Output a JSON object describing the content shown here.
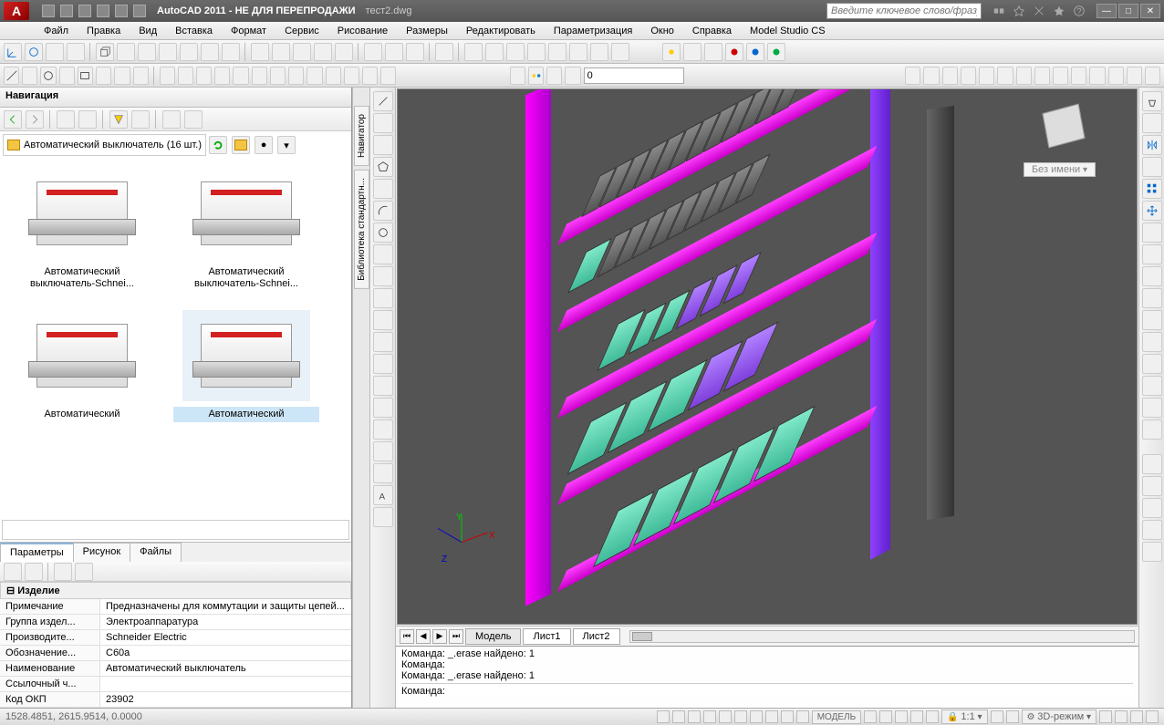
{
  "title": {
    "app": "AutoCAD 2011",
    "subtitle": "НЕ ДЛЯ ПЕРЕПРОДАЖИ",
    "file": "тест2.dwg"
  },
  "search": {
    "placeholder": "Введите ключевое слово/фразу"
  },
  "menu": [
    "Файл",
    "Правка",
    "Вид",
    "Вставка",
    "Формат",
    "Сервис",
    "Рисование",
    "Размеры",
    "Редактировать",
    "Параметризация",
    "Окно",
    "Справка",
    "Model Studio CS"
  ],
  "layer_value": "0",
  "nav": {
    "title": "Навигация",
    "path": "Автоматический выключатель (16 шт.)",
    "items": [
      {
        "label": "Автоматический выключатель-Schnei..."
      },
      {
        "label": "Автоматический выключатель-Schnei..."
      },
      {
        "label": "Автоматический"
      },
      {
        "label": "Автоматический"
      }
    ]
  },
  "sidetabs": [
    "Навигатор",
    "Библиотека стандартн..."
  ],
  "props": {
    "tabs": [
      "Параметры",
      "Рисунок",
      "Файлы"
    ],
    "section": "Изделие",
    "rows": [
      {
        "k": "Примечание",
        "v": "Предназначены для коммутации и  защиты цепей..."
      },
      {
        "k": "Группа издел...",
        "v": "Электроаппаратура"
      },
      {
        "k": "Производите...",
        "v": "Schneider Electric"
      },
      {
        "k": "Обозначение...",
        "v": "C60a"
      },
      {
        "k": "Наименование",
        "v": "Автоматический выключатель"
      },
      {
        "k": "Ссылочный ч...",
        "v": ""
      },
      {
        "k": "Код ОКП",
        "v": "23902"
      }
    ]
  },
  "viewport": {
    "unnamed": "Без имени",
    "axes": {
      "x": "X",
      "y": "Y",
      "z": "Z"
    }
  },
  "model_tabs": [
    "Модель",
    "Лист1",
    "Лист2"
  ],
  "cmd": {
    "lines": [
      "Команда: _.erase найдено: 1",
      "Команда:",
      "Команда: _.erase найдено: 1"
    ],
    "prompt": "Команда:"
  },
  "status": {
    "coords": "1528.4851, 2615.9514, 0.0000",
    "model": "МОДЕЛЬ",
    "scale": "1:1",
    "mode3d": "3D-режим"
  }
}
